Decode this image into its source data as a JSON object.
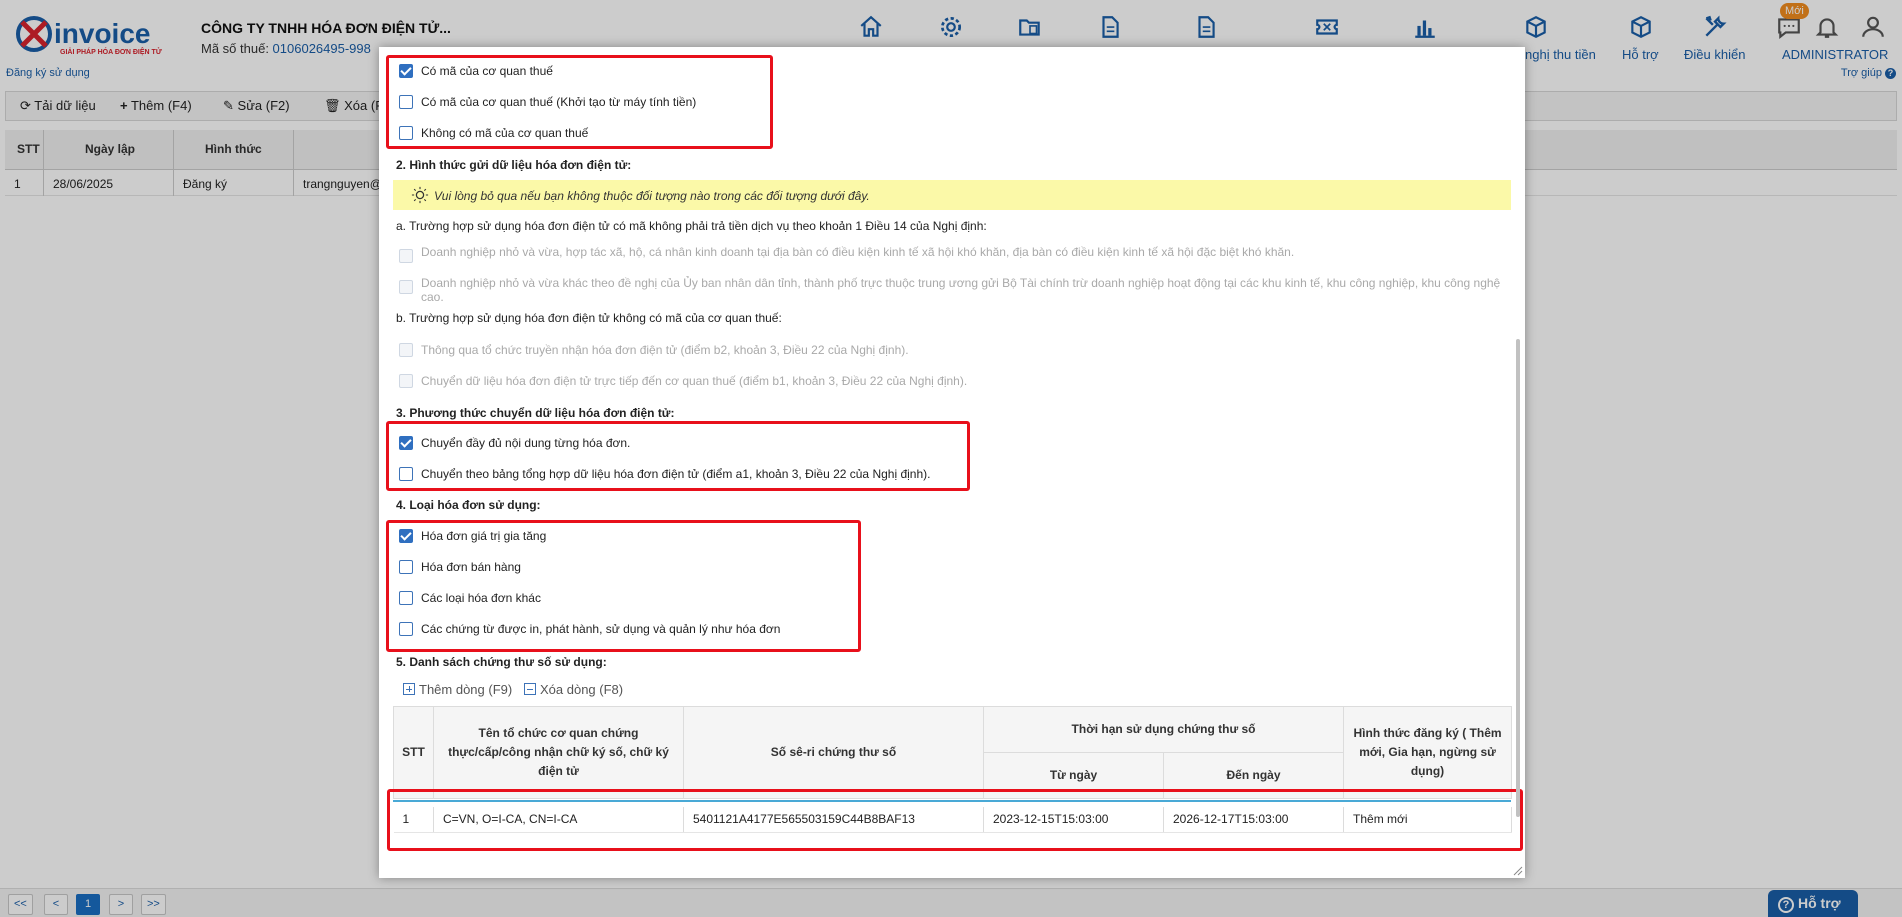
{
  "header": {
    "company_name": "CÔNG TY TNHH HÓA ĐƠN ĐIỆN TỬ...",
    "tax_label": "Mã số thuế: ",
    "tax_code": "0106026495-998",
    "register_link": "Đăng ký sử dụng",
    "help_link": "Trợ giúp",
    "badge_new": "Mới",
    "nav_labels": {
      "de_nghi": "nghị thu tiền",
      "ho_tro": "Hỗ trợ",
      "dieu_khien": "Điều khiển",
      "user": "ADMINISTRATOR"
    },
    "icons": [
      "home-icon",
      "gear-icon",
      "folder-copy-icon",
      "document-icon",
      "document-icon",
      "ticket-icon",
      "bar-chart-icon",
      "box-icon",
      "box-icon",
      "tools-icon",
      "chat-icon",
      "bell-icon",
      "user-icon"
    ]
  },
  "toolbar": {
    "reload": "Tải dữ liệu",
    "add": "Thêm (F4)",
    "edit": "Sửa (F2)",
    "delete": "Xóa (F"
  },
  "grid": {
    "columns": [
      "STT",
      "Ngày lập",
      "Hình thức"
    ],
    "rows": [
      {
        "stt": "1",
        "date": "28/06/2025",
        "type": "Đăng ký",
        "user": "trangnguyen@"
      }
    ]
  },
  "pager": {
    "first": "<<",
    "prev": "<",
    "page": "1",
    "next": ">",
    "last": ">>"
  },
  "support_button": "Hỗ trợ",
  "modal": {
    "opt_top": [
      {
        "label": "Có mã của cơ quan thuế",
        "checked": true
      },
      {
        "label": "Có mã của cơ quan thuế (Khởi tạo từ máy tính tiền)",
        "checked": false
      },
      {
        "label": "Không có mã của cơ quan thuế",
        "checked": false
      }
    ],
    "section2_title": "2. Hình thức gửi dữ liệu hóa đơn điện tử:",
    "section2_note": "Vui lòng bỏ qua nếu bạn không thuộc đối tượng nào trong các đối tượng dưới đây.",
    "section2a_title": "a. Trường hợp sử dụng hóa đơn điện tử có mã không phải trả tiền dịch vụ theo khoản 1 Điều 14 của Nghị định:",
    "section2a_opts": [
      {
        "label": "Doanh nghiệp nhỏ và vừa, hợp tác xã, hộ, cá nhân kinh doanh tại địa bàn có điều kiện kinh tế xã hội khó khăn, địa bàn có điều kiện kinh tế xã hội đặc biệt khó khăn."
      },
      {
        "label": "Doanh nghiệp nhỏ và vừa khác theo đề nghị của Ủy ban nhân dân tỉnh, thành phố trực thuộc trung ương gửi Bộ Tài chính trừ doanh nghiệp hoạt động tại các khu kinh tế, khu công nghiệp, khu công nghệ",
        "label2": "cao."
      }
    ],
    "section2b_title": "b. Trường hợp sử dụng hóa đơn điện tử không có mã của cơ quan thuế:",
    "section2b_opts": [
      {
        "label": "Thông qua tổ chức truyền nhận hóa đơn điện tử (điểm b2, khoản 3, Điều 22 của Nghị định)."
      },
      {
        "label": "Chuyển dữ liệu hóa đơn điện tử trực tiếp đến cơ quan thuế (điểm b1, khoản 3, Điều 22 của Nghị định)."
      }
    ],
    "section3_title": "3. Phương thức chuyển dữ liệu hóa đơn điện tử:",
    "section3_opts": [
      {
        "label": "Chuyển đầy đủ nội dung từng hóa đơn.",
        "checked": true
      },
      {
        "label": "Chuyển theo bảng tổng hợp dữ liệu hóa đơn điện tử (điểm a1, khoản 3, Điều 22 của Nghị định).",
        "checked": false
      }
    ],
    "section4_title": "4. Loại hóa đơn sử dụng:",
    "section4_opts": [
      {
        "label": "Hóa đơn giá trị gia tăng",
        "checked": true
      },
      {
        "label": "Hóa đơn bán hàng",
        "checked": false
      },
      {
        "label": "Các loại hóa đơn khác",
        "checked": false
      },
      {
        "label": "Các chứng từ được in, phát hành, sử dụng và quản lý như hóa đơn",
        "checked": false
      }
    ],
    "section5_title": "5. Danh sách chứng thư số sử dụng:",
    "add_row": "Thêm dòng (F9)",
    "delete_row": "Xóa dòng (F8)",
    "table": {
      "h_stt": "STT",
      "h_org": "Tên tổ chức cơ quan chứng thực/cấp/công nhận chữ ký số, chữ ký điện tử",
      "h_serial": "Số sê-ri chứng thư số",
      "h_validity": "Thời hạn sử dụng chứng thư số",
      "h_from": "Từ ngày",
      "h_to": "Đến ngày",
      "h_type": "Hình thức đăng ký ( Thêm mới, Gia hạn, ngừng sử dụng)",
      "rows": [
        {
          "stt": "1",
          "org": "C=VN, O=I-CA, CN=I-CA",
          "serial": "5401121A4177E565503159C44B8BAF13",
          "from": "2023-12-15T15:03:00",
          "to": "2026-12-17T15:03:00",
          "type": "Thêm mới"
        }
      ]
    }
  }
}
